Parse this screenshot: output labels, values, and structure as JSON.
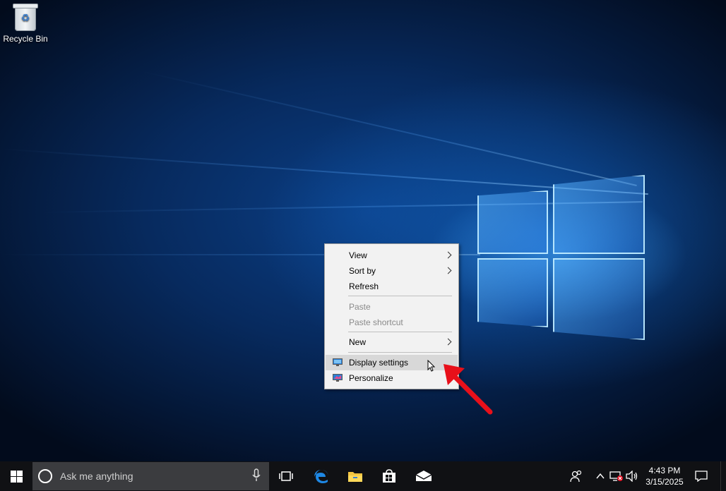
{
  "desktop": {
    "icons": [
      {
        "label": "Recycle Bin",
        "icon": "recycle-bin-icon"
      }
    ]
  },
  "context_menu": {
    "items": [
      {
        "label": "View",
        "has_submenu": true,
        "enabled": true
      },
      {
        "label": "Sort by",
        "has_submenu": true,
        "enabled": true
      },
      {
        "label": "Refresh",
        "has_submenu": false,
        "enabled": true
      },
      {
        "label": "Paste",
        "has_submenu": false,
        "enabled": false
      },
      {
        "label": "Paste shortcut",
        "has_submenu": false,
        "enabled": false
      },
      {
        "label": "New",
        "has_submenu": true,
        "enabled": true
      },
      {
        "label": "Display settings",
        "has_submenu": false,
        "enabled": true,
        "highlighted": true,
        "icon": "display-icon"
      },
      {
        "label": "Personalize",
        "has_submenu": false,
        "enabled": true,
        "icon": "personalize-icon"
      }
    ]
  },
  "annotation": {
    "color": "#e8101a",
    "points_to": "Display settings"
  },
  "taskbar": {
    "search_placeholder": "Ask me anything",
    "pinned": [
      "task-view-icon",
      "edge-icon",
      "file-explorer-icon",
      "store-icon",
      "mail-icon"
    ],
    "tray": {
      "time": "4:43 PM",
      "date": "3/15/2025"
    }
  },
  "colors": {
    "accent": "#1e88e5",
    "taskbar": "#101114",
    "menu_bg": "#f2f2f2"
  }
}
